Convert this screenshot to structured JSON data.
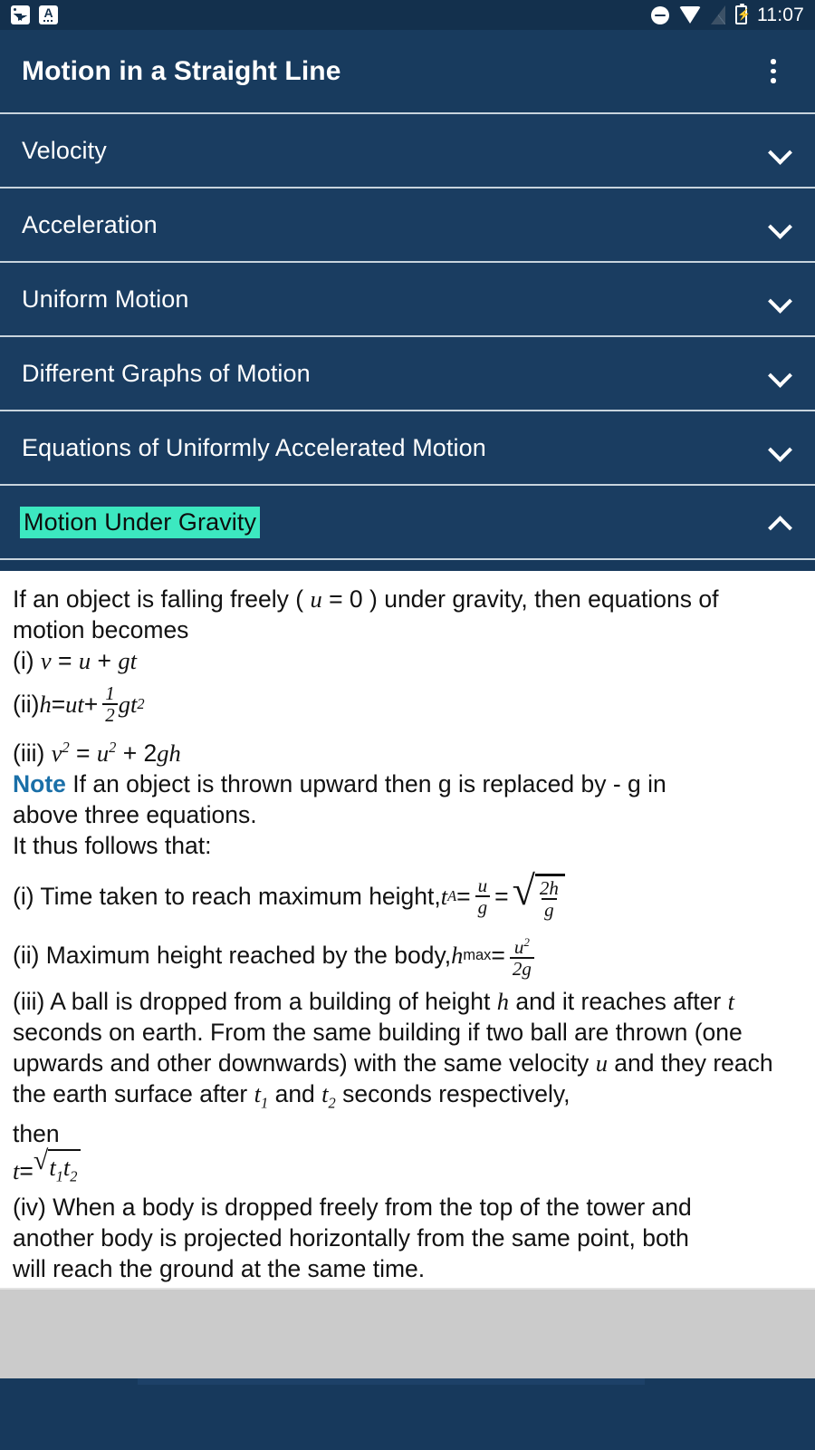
{
  "status_bar": {
    "notifications": [
      {
        "icon": "photo-notification-icon"
      },
      {
        "icon": "translate-notification-icon",
        "glyph": "A"
      }
    ],
    "indicators": [
      {
        "icon": "do-not-disturb-icon"
      },
      {
        "icon": "wifi-icon"
      },
      {
        "icon": "mobile-signal-off-icon"
      },
      {
        "icon": "battery-charging-icon"
      }
    ],
    "time": "11:07"
  },
  "app_bar": {
    "title": "Motion in a Straight Line",
    "overflow_icon": "more-vert-icon"
  },
  "accordion": {
    "items": [
      {
        "label": "Velocity",
        "expanded": false,
        "chevron": "chevron-down-icon"
      },
      {
        "label": "Acceleration",
        "expanded": false,
        "chevron": "chevron-down-icon"
      },
      {
        "label": "Uniform Motion",
        "expanded": false,
        "chevron": "chevron-down-icon"
      },
      {
        "label": "Different Graphs of Motion",
        "expanded": false,
        "chevron": "chevron-down-icon"
      },
      {
        "label": "Equations of Uniformly Accelerated Motion",
        "expanded": false,
        "chevron": "chevron-down-icon"
      },
      {
        "label": "Motion Under Gravity",
        "expanded": true,
        "chevron": "chevron-up-icon",
        "highlight_color": "#3ce8c0"
      }
    ]
  },
  "content": {
    "intro_a": "If an object is falling freely ( ",
    "intro_u": "u",
    "intro_b": " = 0 ) under gravity, then equations of",
    "intro_c": "motion becomes",
    "eq1_label": "(i) ",
    "eq1_v": "v",
    "eq1_eq": " = ",
    "eq1_u": "u",
    "eq1_plus": " + ",
    "eq1_gt": "gt",
    "eq2_label": "(ii) ",
    "eq2_h": "h",
    "eq2_eq": " = ",
    "eq2_ut": "ut",
    "eq2_plus": " + ",
    "eq2_num": "1",
    "eq2_den": "2",
    "eq2_g": "g",
    "eq2_t": "t",
    "eq2_sup": "2",
    "eq3_label": "(iii) ",
    "eq3_v": "v",
    "eq3_vsup": "2",
    "eq3_eq": " = ",
    "eq3_u": "u",
    "eq3_usup": "2",
    "eq3_plus": " + 2",
    "eq3_gh": "gh",
    "note_word": "Note",
    "note_text": " If an object is thrown upward then g is replaced by - g in",
    "note_text2": "above three equations.",
    "follows": "It thus follows that:",
    "t1_label": "(i) Time taken to reach maximum height, ",
    "t1_t": "t",
    "t1_sub": "A",
    "t1_eq1": " = ",
    "t1_num": "u",
    "t1_den": "g",
    "t1_eq2": " = ",
    "t1_rnum": "2h",
    "t1_rden": "g",
    "t2_label": "(ii) Maximum height reached by the body, ",
    "t2_h": "h",
    "t2_sub": "max",
    "t2_eq": " = ",
    "t2_num": "u",
    "t2_numsup": "2",
    "t2_den": "2g",
    "p3_a": "(iii) A ball is dropped from a building of height ",
    "p3_h": "h",
    "p3_b": " and it reaches after",
    "p3_t": "t",
    "p3_c": " seconds on earth. From the same building if two ball are thrown",
    "p3_d": "(one upwards and other downwards) with the same velocity ",
    "p3_u": "u",
    "p3_e": " and",
    "p3_f": "they reach the earth surface after ",
    "p3_t1": "t",
    "p3_t1sub": "1",
    "p3_and": " and ",
    "p3_t2": "t",
    "p3_t2sub": "2",
    "p3_g": " seconds respectively,",
    "p3_then": "then",
    "eqt_t": "t",
    "eqt_eq": " = ",
    "eqt_r1": "t",
    "eqt_r1sub": "1",
    "eqt_r2": "t",
    "eqt_r2sub": "2",
    "p4_a": "(iv) When a body is dropped freely from the top of the tower and",
    "p4_b": "another body is projected horizontally from the same point, both",
    "p4_c": "will reach the ground at the same time."
  },
  "bottom": {
    "ad_placeholder": "",
    "nav_bar": ""
  },
  "theme": {
    "app_bar_bg": "#183b5e",
    "list_bg": "#1a3d61",
    "status_bar_bg": "#13304d",
    "divider": "#c8d4dd",
    "highlight": "#3ce8c0",
    "note_blue": "#1a6fa8",
    "ad_bg": "#cbcbcb",
    "nav_bg": "#17395c"
  }
}
